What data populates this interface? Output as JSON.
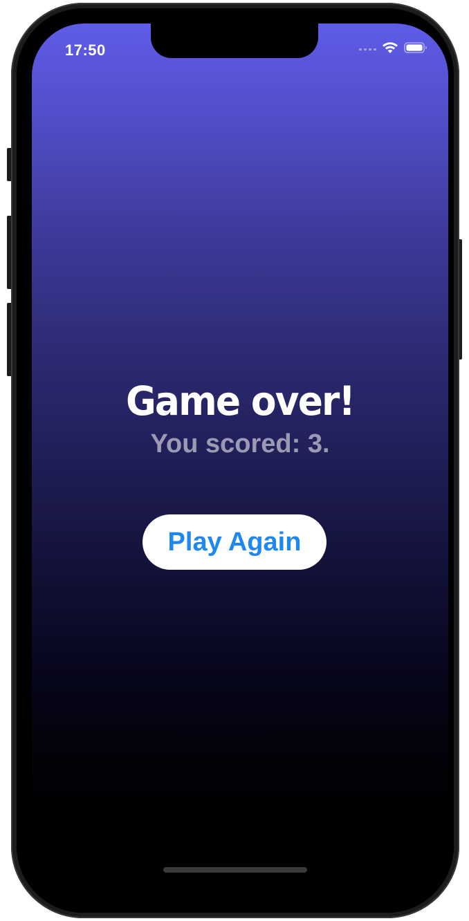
{
  "status_bar": {
    "time": "17:50",
    "icons": [
      "cellular-signal-icon",
      "wifi-icon",
      "battery-icon"
    ]
  },
  "game_over": {
    "title": "Game over!",
    "score_text": "You scored: 3.",
    "play_again_label": "Play Again"
  },
  "colors": {
    "gradient_top": "#5f5ce8",
    "gradient_bottom": "#000000",
    "button_text": "#1e88f0",
    "button_background": "#ffffff"
  }
}
